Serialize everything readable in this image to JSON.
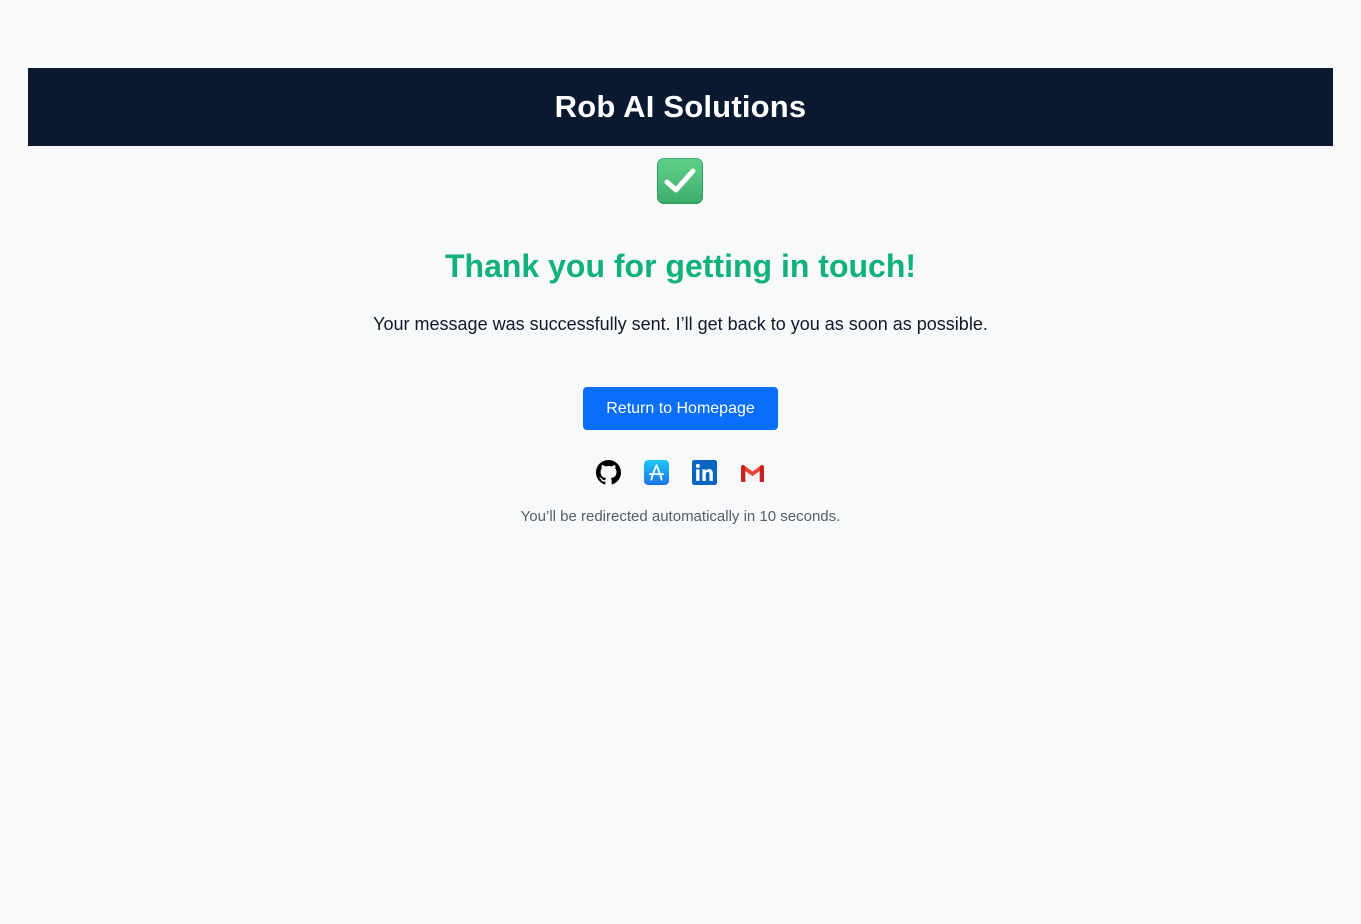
{
  "header": {
    "title": "Rob AI Solutions",
    "background_color": "#0a1930"
  },
  "status": {
    "icon": "check-mark-icon",
    "heading": "Thank you for getting in touch!",
    "heading_color": "#10b27a",
    "message": "Your message was successfully sent. I’ll get back to you as soon as possible."
  },
  "actions": {
    "home_button_label": "Return to Homepage",
    "button_color": "#0a6efd"
  },
  "social_links": [
    {
      "name": "github",
      "icon": "github-icon"
    },
    {
      "name": "app-store",
      "icon": "app-store-icon"
    },
    {
      "name": "linkedin",
      "icon": "linkedin-icon"
    },
    {
      "name": "gmail",
      "icon": "gmail-icon"
    }
  ],
  "footer": {
    "redirect_text": "You’ll be redirected automatically in 10 seconds."
  }
}
